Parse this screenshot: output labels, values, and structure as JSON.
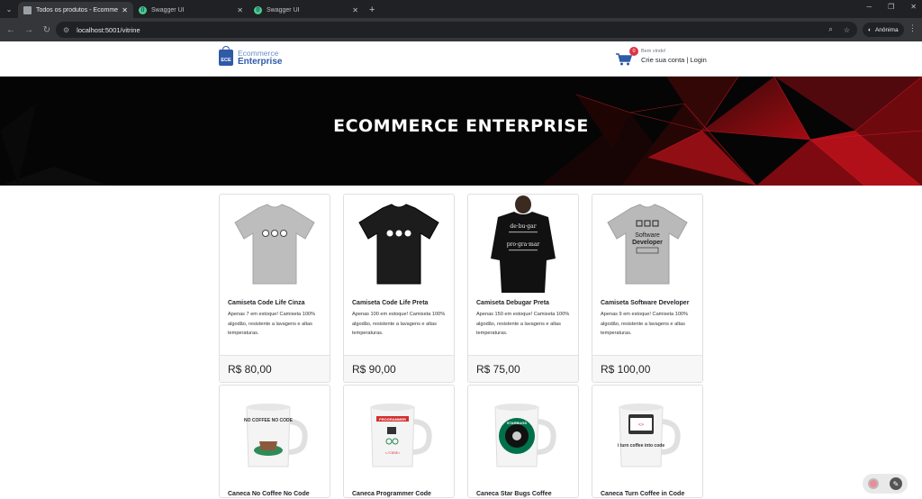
{
  "browser": {
    "tabs": [
      {
        "title": "Todos os produtos - Ecommerce",
        "icon": "document-icon",
        "active": true
      },
      {
        "title": "Swagger UI",
        "icon": "swagger-icon",
        "active": false
      },
      {
        "title": "Swagger UI",
        "icon": "swagger-icon",
        "active": false
      }
    ],
    "url": "localhost:5001/vitrine",
    "profile_label": "Anônima"
  },
  "header": {
    "brand_line1": "Ecommerce",
    "brand_line2": "Enterprise",
    "brand_badge": "ECE",
    "cart_count": "0",
    "greeting": "Bem vindo!",
    "signup_label": "Crie sua conta",
    "separator": "|",
    "login_label": "Login"
  },
  "hero": {
    "title": "ECOMMERCE ENTERPRISE"
  },
  "products": [
    {
      "name": "Camiseta Code Life Cinza",
      "desc": "Apenas 7 em estoque! Camiseta 100% algodão, resistente a lavagens e altas temperaturas.",
      "price": "R$ 80,00",
      "kind": "tshirt",
      "color": "#bdbdbd",
      "print": "codelife"
    },
    {
      "name": "Camiseta Code Life Preta",
      "desc": "Apenas 100 em estoque! Camiseta 100% algodão, resistente a lavagens e altas temperaturas.",
      "price": "R$ 90,00",
      "kind": "tshirt",
      "color": "#1c1c1c",
      "print": "codelife"
    },
    {
      "name": "Camiseta Debugar Preta",
      "desc": "Apenas 150 em estoque! Camiseta 100% algodão, resistente a lavagens e altas temperaturas.",
      "price": "R$ 75,00",
      "kind": "model",
      "color": "#111111",
      "print": "debugar"
    },
    {
      "name": "Camiseta Software Developer",
      "desc": "Apenas 9 em estoque! Camiseta 100% algodão, resistente a lavagens e altas temperaturas.",
      "price": "R$ 100,00",
      "kind": "tshirt",
      "color": "#b9b9b9",
      "print": "softdev"
    },
    {
      "name": "Caneca No Coffee No Code",
      "desc": "",
      "price": "",
      "kind": "mug",
      "color": "#2e8b57",
      "print": "nocoffee"
    },
    {
      "name": "Caneca Programmer Code",
      "desc": "",
      "price": "",
      "kind": "mug",
      "color": "#d32f2f",
      "print": "programmer"
    },
    {
      "name": "Caneca Star Bugs Coffee",
      "desc": "",
      "price": "",
      "kind": "mug",
      "color": "#00704a",
      "print": "starbugs"
    },
    {
      "name": "Caneca Turn Coffee in Code",
      "desc": "",
      "price": "",
      "kind": "mug",
      "color": "#333333",
      "print": "turncoffee"
    }
  ],
  "print_text": {
    "debugar_1": "de·bu·gar",
    "debugar_2": "pro·gra·mar",
    "softdev_1": "Software",
    "softdev_2": "Developer",
    "nocoffee": "NO COFFEE NO CODE",
    "programmer": "PROGRAMMER",
    "programmer_sub": "</CODE>",
    "starbugs": "STARBUGS",
    "turncoffee": "i turn coffee into code"
  }
}
